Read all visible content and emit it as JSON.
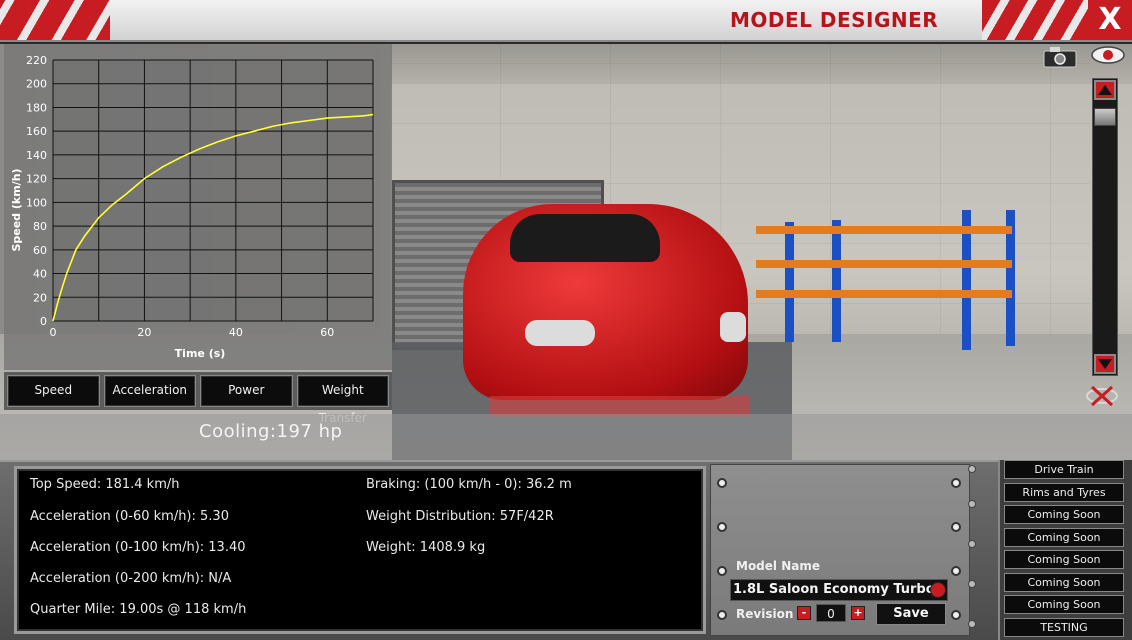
{
  "window": {
    "title": "MODEL DESIGNER",
    "close_label": "X"
  },
  "graph_tabs": [
    {
      "label": "Speed"
    },
    {
      "label": "Acceleration"
    },
    {
      "label": "Power"
    },
    {
      "label": "Weight Transfer"
    }
  ],
  "cooling": {
    "text": "Cooling:197 hp"
  },
  "stats": {
    "top_speed": "Top Speed: 181.4 km/h",
    "accel_0_60": "Acceleration (0-60 km/h): 5.30",
    "accel_0_100": "Acceleration (0-100 km/h): 13.40",
    "accel_0_200": "Acceleration (0-200 km/h): N/A",
    "quarter_mile": "Quarter Mile: 19.00s @ 118 km/h",
    "braking": "Braking: (100 km/h - 0): 36.2 m",
    "weight_distribution": "Weight Distribution: 57F/42R",
    "weight": "Weight: 1408.9 kg"
  },
  "model": {
    "name_label": "Model Name",
    "name_value": "1.8L Saloon Economy Turbo",
    "revision_label": "Revision",
    "revision_value": "0",
    "minus_label": "-",
    "plus_label": "+",
    "save_label": "Save"
  },
  "side_menu": [
    {
      "label": "Drive Train"
    },
    {
      "label": "Rims and Tyres"
    },
    {
      "label": "Coming Soon"
    },
    {
      "label": "Coming Soon"
    },
    {
      "label": "Coming Soon"
    },
    {
      "label": "Coming Soon"
    },
    {
      "label": "Coming Soon"
    },
    {
      "label": "TESTING"
    }
  ],
  "icons": {
    "camera": "camera-icon",
    "eye": "eye-icon",
    "zoom_up": "arrow-up-icon",
    "zoom_down": "arrow-down-icon",
    "hide": "eye-crossed-icon"
  },
  "colors": {
    "accent_red": "#c61c22",
    "curve": "#ffff33",
    "panel_bg": "#000000"
  },
  "chart_data": {
    "type": "line",
    "title": "",
    "xlabel": "Time (s)",
    "ylabel": "Speed (km/h)",
    "xlim": [
      0,
      70
    ],
    "ylim": [
      0,
      220
    ],
    "x_ticks": [
      0,
      20,
      40,
      60
    ],
    "y_ticks": [
      0,
      20,
      40,
      60,
      80,
      100,
      120,
      140,
      160,
      180,
      200,
      220
    ],
    "grid": true,
    "series": [
      {
        "x": [
          0,
          1,
          2,
          3,
          5,
          7,
          10,
          13,
          16,
          20,
          24,
          28,
          32,
          36,
          40,
          44,
          48,
          52,
          56,
          60,
          64,
          68,
          70
        ],
        "y": [
          0,
          15,
          28,
          40,
          60,
          72,
          87,
          98,
          107,
          120,
          130,
          138,
          145,
          151,
          156,
          160,
          164,
          167,
          169,
          171,
          172,
          173,
          174
        ]
      }
    ]
  }
}
